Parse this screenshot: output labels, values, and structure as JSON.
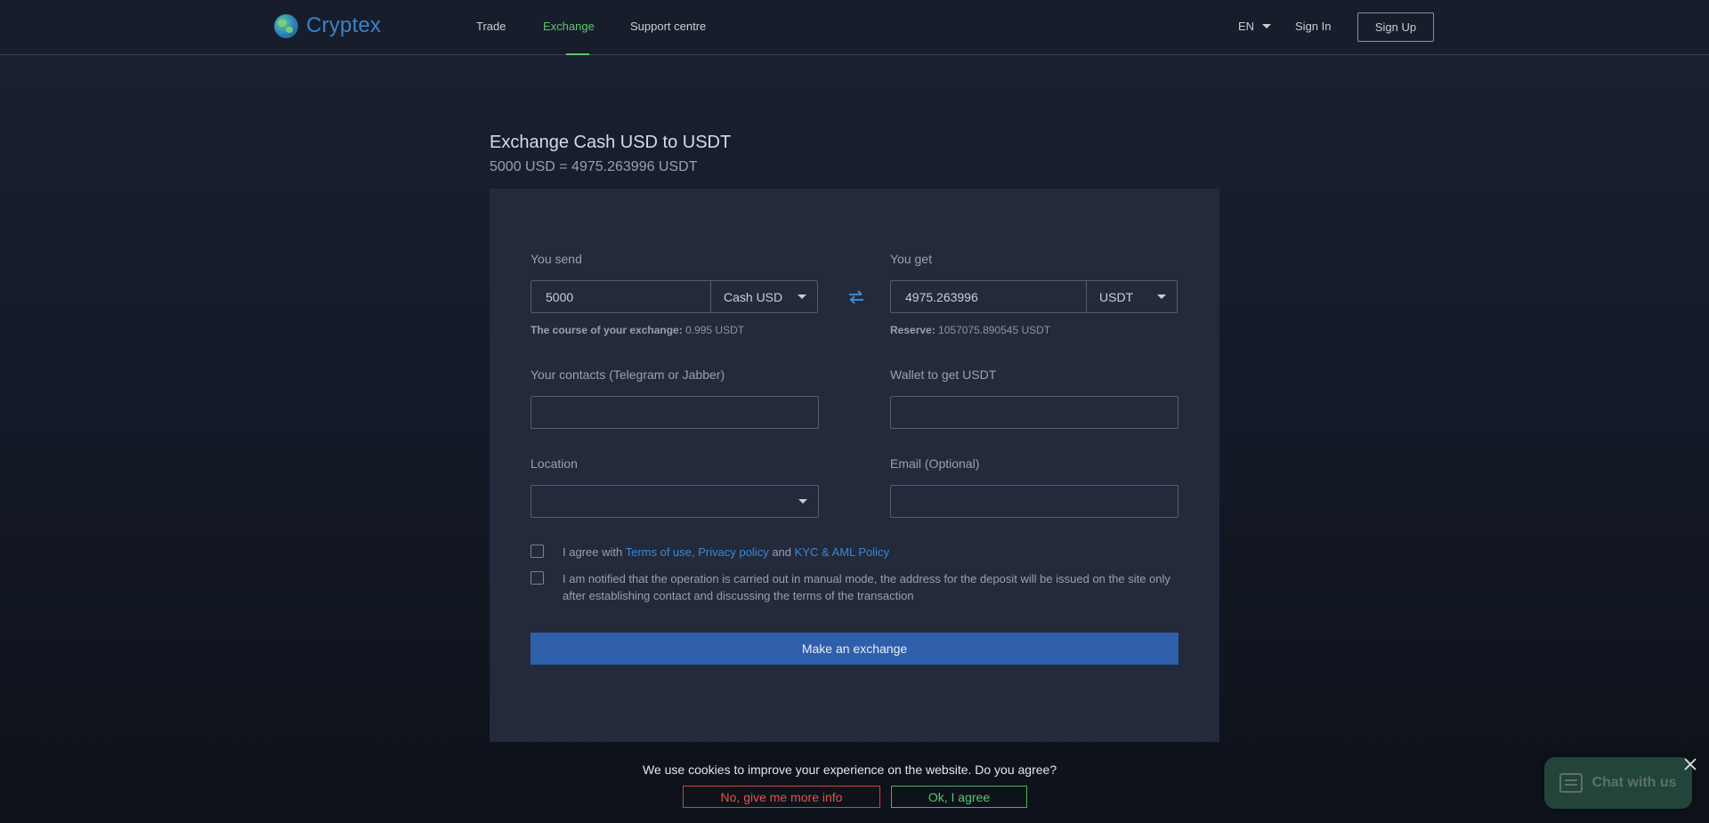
{
  "header": {
    "logo_text": "Cryptex",
    "nav": [
      {
        "label": "Trade",
        "active": false
      },
      {
        "label": "Exchange",
        "active": true
      },
      {
        "label": "Support centre",
        "active": false
      }
    ],
    "language": "EN",
    "sign_in": "Sign In",
    "sign_up": "Sign Up"
  },
  "exchange": {
    "title": "Exchange Cash USD to USDT",
    "rate_line": "5000 USD = 4975.263996 USDT",
    "send": {
      "label": "You send",
      "amount": "5000",
      "currency": "Cash USD",
      "course_label": "The course of your exchange:",
      "course_value": "0.995 USDT"
    },
    "get": {
      "label": "You get",
      "amount": "4975.263996",
      "currency": "USDT",
      "reserve_label": "Reserve:",
      "reserve_value": "1057075.890545 USDT"
    },
    "contacts": {
      "label": "Your contacts (Telegram or Jabber)",
      "value": ""
    },
    "wallet": {
      "label": "Wallet to get USDT",
      "value": ""
    },
    "location": {
      "label": "Location",
      "value": ""
    },
    "email": {
      "label": "Email (Optional)",
      "value": ""
    },
    "agree": {
      "prefix": "I agree with ",
      "terms_link": "Terms of use, Privacy policy",
      "and": " and ",
      "kyc_link": "KYC & AML Policy",
      "checked": false
    },
    "notified": {
      "text": "I am notified that the operation is carried out in manual mode, the address for the deposit will be issued on the site only after establishing contact and discussing the terms of the transaction",
      "checked": false
    },
    "submit_label": "Make an exchange"
  },
  "cookie": {
    "text": "We use cookies to improve your experience on the website. Do you agree?",
    "decline": "No, give me more info",
    "accept": "Ok, I agree"
  },
  "chat": {
    "label": "Chat with us"
  },
  "colors": {
    "accent_green": "#5cc66b",
    "link_blue": "#3f86cf",
    "button_blue": "#2f5fab",
    "decline_red": "#e0564c"
  }
}
